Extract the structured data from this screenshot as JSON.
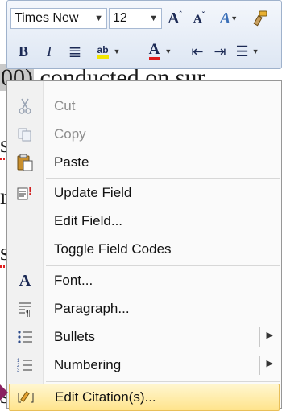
{
  "document": {
    "fragment_top_highlight": "00)",
    "fragment_top_rest": " conducted on sur",
    "fragment_s1": "s",
    "fragment_r": "r",
    "fragment_s2": "s",
    "fragment_s3": "s"
  },
  "toolbar": {
    "font_name": "Times New",
    "font_size": "12",
    "buttons": [
      {
        "name": "grow-font-button",
        "glyph": "Aˆ"
      },
      {
        "name": "shrink-font-button",
        "glyph": "Aˇ"
      },
      {
        "name": "styles-button",
        "glyph": "A"
      },
      {
        "name": "format-painter-button",
        "glyph": "✎"
      }
    ],
    "row2": {
      "bold": "B",
      "italic": "I",
      "center": "≣",
      "highlight": "ab",
      "font_color": "A",
      "indent_dec": "⇤",
      "indent_inc": "⇥",
      "bullets": "☰"
    }
  },
  "menu": {
    "items": [
      {
        "label": "Cut",
        "icon": "scissors-icon",
        "enabled": false
      },
      {
        "label": "Copy",
        "icon": "copy-icon",
        "enabled": false
      },
      {
        "label": "Paste",
        "icon": "paste-icon",
        "enabled": true
      },
      {
        "label": "Update Field",
        "icon": "update-field-icon",
        "enabled": true
      },
      {
        "label": "Edit Field...",
        "icon": "",
        "enabled": true
      },
      {
        "label": "Toggle Field Codes",
        "icon": "",
        "enabled": true
      },
      {
        "label": "Font...",
        "icon": "font-icon",
        "enabled": true
      },
      {
        "label": "Paragraph...",
        "icon": "paragraph-icon",
        "enabled": true
      },
      {
        "label": "Bullets",
        "icon": "bullets-icon",
        "enabled": true,
        "submenu": true
      },
      {
        "label": "Numbering",
        "icon": "numbering-icon",
        "enabled": true,
        "submenu": true
      },
      {
        "label": "Edit Citation(s)...",
        "icon": "edit-citation-icon",
        "enabled": true,
        "highlighted": true
      }
    ]
  },
  "colors": {
    "highlight_bg": "#ffe48c",
    "font_color_bar": "#e01b1b",
    "highlight_bar": "#f2e600"
  }
}
